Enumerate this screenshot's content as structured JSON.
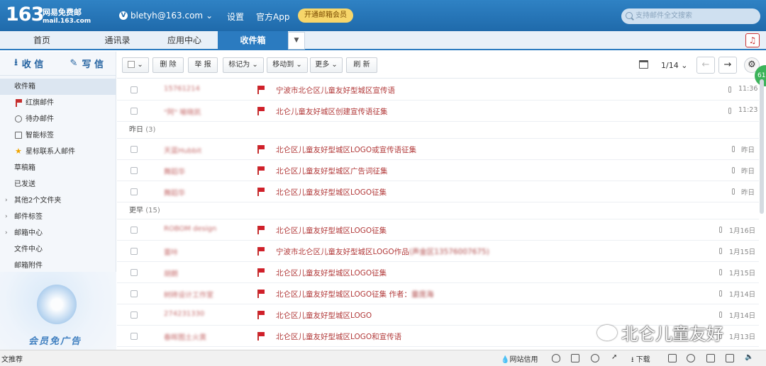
{
  "header": {
    "logo_num": "163",
    "logo_cn": "网易免费邮",
    "logo_domain": "mail.163.com",
    "account": "bletyh@163.com",
    "links": [
      "设置",
      "官方App"
    ],
    "vip_button": "开通邮箱会员",
    "search_placeholder": "支持邮件全文搜索"
  },
  "tabs": [
    "首页",
    "通讯录",
    "应用中心",
    "收件箱"
  ],
  "sidebar": {
    "receive": "收 信",
    "write": "写 信",
    "items": [
      "收件箱",
      "红旗邮件",
      "待办邮件",
      "智能标签",
      "星标联系人邮件",
      "草稿箱",
      "已发送",
      "其他2个文件夹",
      "邮件标签",
      "邮箱中心",
      "文件中心",
      "邮箱附件"
    ],
    "ad_text": "会员免广告"
  },
  "toolbar": {
    "delete": "删 除",
    "report": "举 报",
    "mark": "标记为",
    "move": "移动到",
    "more": "更多",
    "refresh": "刷 新",
    "page": "1/14"
  },
  "badge": "61",
  "groups": {
    "yesterday": "昨日",
    "yesterday_count": "(3)",
    "earlier": "更早",
    "earlier_count": "(15)"
  },
  "mails_today": [
    {
      "sender": "15761214",
      "subject": "宁波市北仑区儿童友好型城区宣传语",
      "tail": "",
      "date": "11:36"
    },
    {
      "sender": "\"阿\" 喻晓凯",
      "subject": "北仑儿童友好城区创建宣传语征集",
      "tail": "",
      "date": "11:23"
    }
  ],
  "mails_yesterday": [
    {
      "sender": "天蓝Hubbit",
      "subject": "北仑区儿童友好型城区LOGO或宣传语征集",
      "tail": "",
      "date": "昨日"
    },
    {
      "sender": "舞蹈华",
      "subject": "北仑区儿童友好型城区广告词征集",
      "tail": "",
      "date": "昨日"
    },
    {
      "sender": "舞蹈华",
      "subject": "北仑区儿童友好型城区LOGO征集",
      "tail": "",
      "date": "昨日"
    }
  ],
  "mails_earlier": [
    {
      "sender": "ROBOM design",
      "subject": "北仑区儿童友好型城区LOGO征集",
      "tail": "",
      "date": "1月16日"
    },
    {
      "sender": "蕾咔",
      "subject": "宁波市北仑区儿童友好型城区LOGO作品",
      "tail": "(声金区13576007675)",
      "date": "1月15日"
    },
    {
      "sender": "胡朗",
      "subject": "北仑区儿童友好型城区LOGO征集",
      "tail": "",
      "date": "1月15日"
    },
    {
      "sender": "树砖设计工作室",
      "subject": "北仑区儿童友好型城区LOGO征集 作者：",
      "tail": "童庞海",
      "date": "1月14日"
    },
    {
      "sender": "274231330",
      "subject": "北仑区儿童友好型城区LOGO",
      "tail": "",
      "date": "1月14日"
    },
    {
      "sender": "春晖图土火黄",
      "subject": "北仑区儿童友好型城区LOGO和宣传语",
      "tail": "",
      "date": "1月13日"
    }
  ],
  "watermark": "北仑儿童友好",
  "statusbar": {
    "left": "文推荐",
    "site_trust": "网站信用",
    "download": "下载"
  }
}
